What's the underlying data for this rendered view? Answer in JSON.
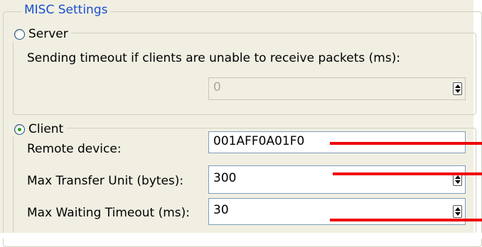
{
  "misc": {
    "title": "MISC Settings"
  },
  "server": {
    "label": "Server",
    "timeout_label": "Sending timeout if clients are unable to receive packets (ms):",
    "timeout_value": "0"
  },
  "client": {
    "label": "Client",
    "remote_device_label": "Remote device:",
    "remote_device_value": "001AFF0A01F0",
    "mtu_label": "Max Transfer Unit (bytes):",
    "mtu_value": "300",
    "timeout_label": "Max Waiting Timeout (ms):",
    "timeout_value": "30"
  },
  "colors": {
    "legend_blue": "#1a4fcf",
    "annotation_red": "#ee0000"
  }
}
